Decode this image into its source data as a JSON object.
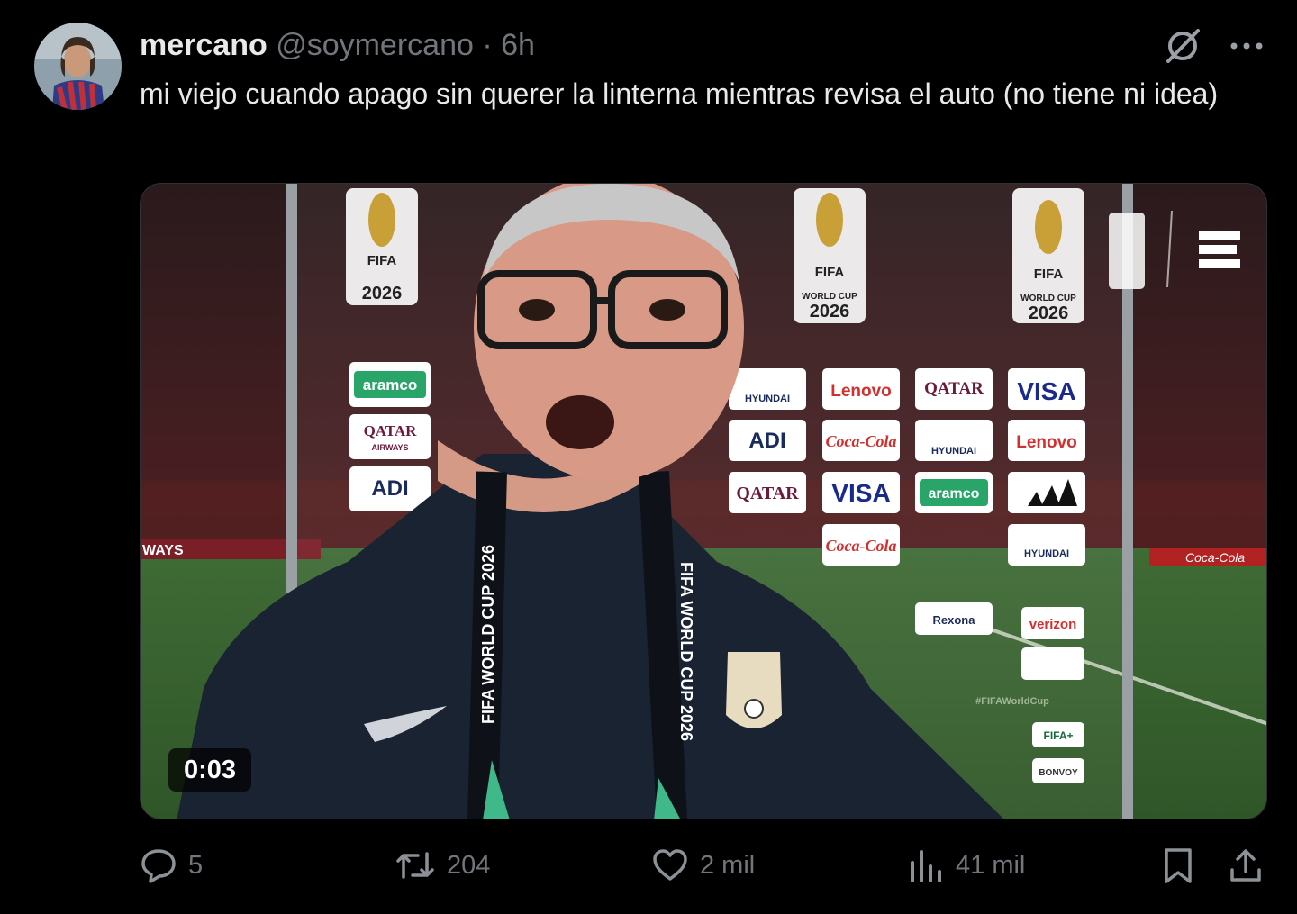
{
  "tweet": {
    "author_name": "mercano",
    "handle": "@soymercano",
    "separator": "·",
    "time": "6h",
    "text": "mi viejo cuando apago sin querer la linterna mientras revisa el auto (no tiene ni idea)",
    "video": {
      "duration": "0:03",
      "overlay_texts": {
        "fifa": "FIFA",
        "world_cup": "WORLD CUP",
        "year": "2026",
        "lanyard": "FIFA WORLD CUP 2026",
        "sponsor_aramco": "aramco",
        "sponsor_qatar": "QATAR",
        "sponsor_qatar_sub": "AIRWAYS",
        "sponsor_visa": "VISA",
        "sponsor_lenovo": "Lenovo",
        "sponsor_cocacola": "Coca-Cola",
        "sponsor_hyundai": "HYUNDAI",
        "sponsor_adi": "ADI",
        "sponsor_verizon": "verizon",
        "sponsor_rexona": "Rexona",
        "sponsor_bonvoy": "BONVOY",
        "sponsor_fifaplus": "FIFA+",
        "hashtag": "#FIFAWorldCup",
        "ways": "WAYS"
      }
    },
    "stats": {
      "replies": "5",
      "reposts": "204",
      "likes": "2 mil",
      "views": "41 mil"
    }
  },
  "icons": {
    "grok": "grok-icon",
    "more": "more-icon",
    "reply": "reply-icon",
    "repost": "repost-icon",
    "like": "heart-icon",
    "views": "views-icon",
    "bookmark": "bookmark-icon",
    "share": "share-icon"
  }
}
